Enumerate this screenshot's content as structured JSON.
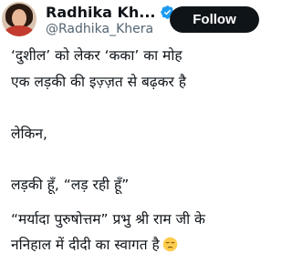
{
  "profile": {
    "display_name": "Radhika Kh...",
    "handle": "@Radhika_Khera",
    "verified_color": "#1d9bf0"
  },
  "actions": {
    "follow_label": "Follow"
  },
  "tweet": {
    "line_1": "‘दुशील’ को लेकर ‘कका’ का मोह",
    "line_2": "एक लड़की की इज़्ज़त से बढ़कर है",
    "line_3": "लेकिन,",
    "line_4": "लड़की हूँ, “लड़ रही हूँ”",
    "line_5": "“मर्यादा पुरुषोत्तम” प्रभु श्री राम जी के",
    "line_6": "ननिहाल में दीदी का स्वागत है",
    "emoji": "pensive-face-icon"
  }
}
